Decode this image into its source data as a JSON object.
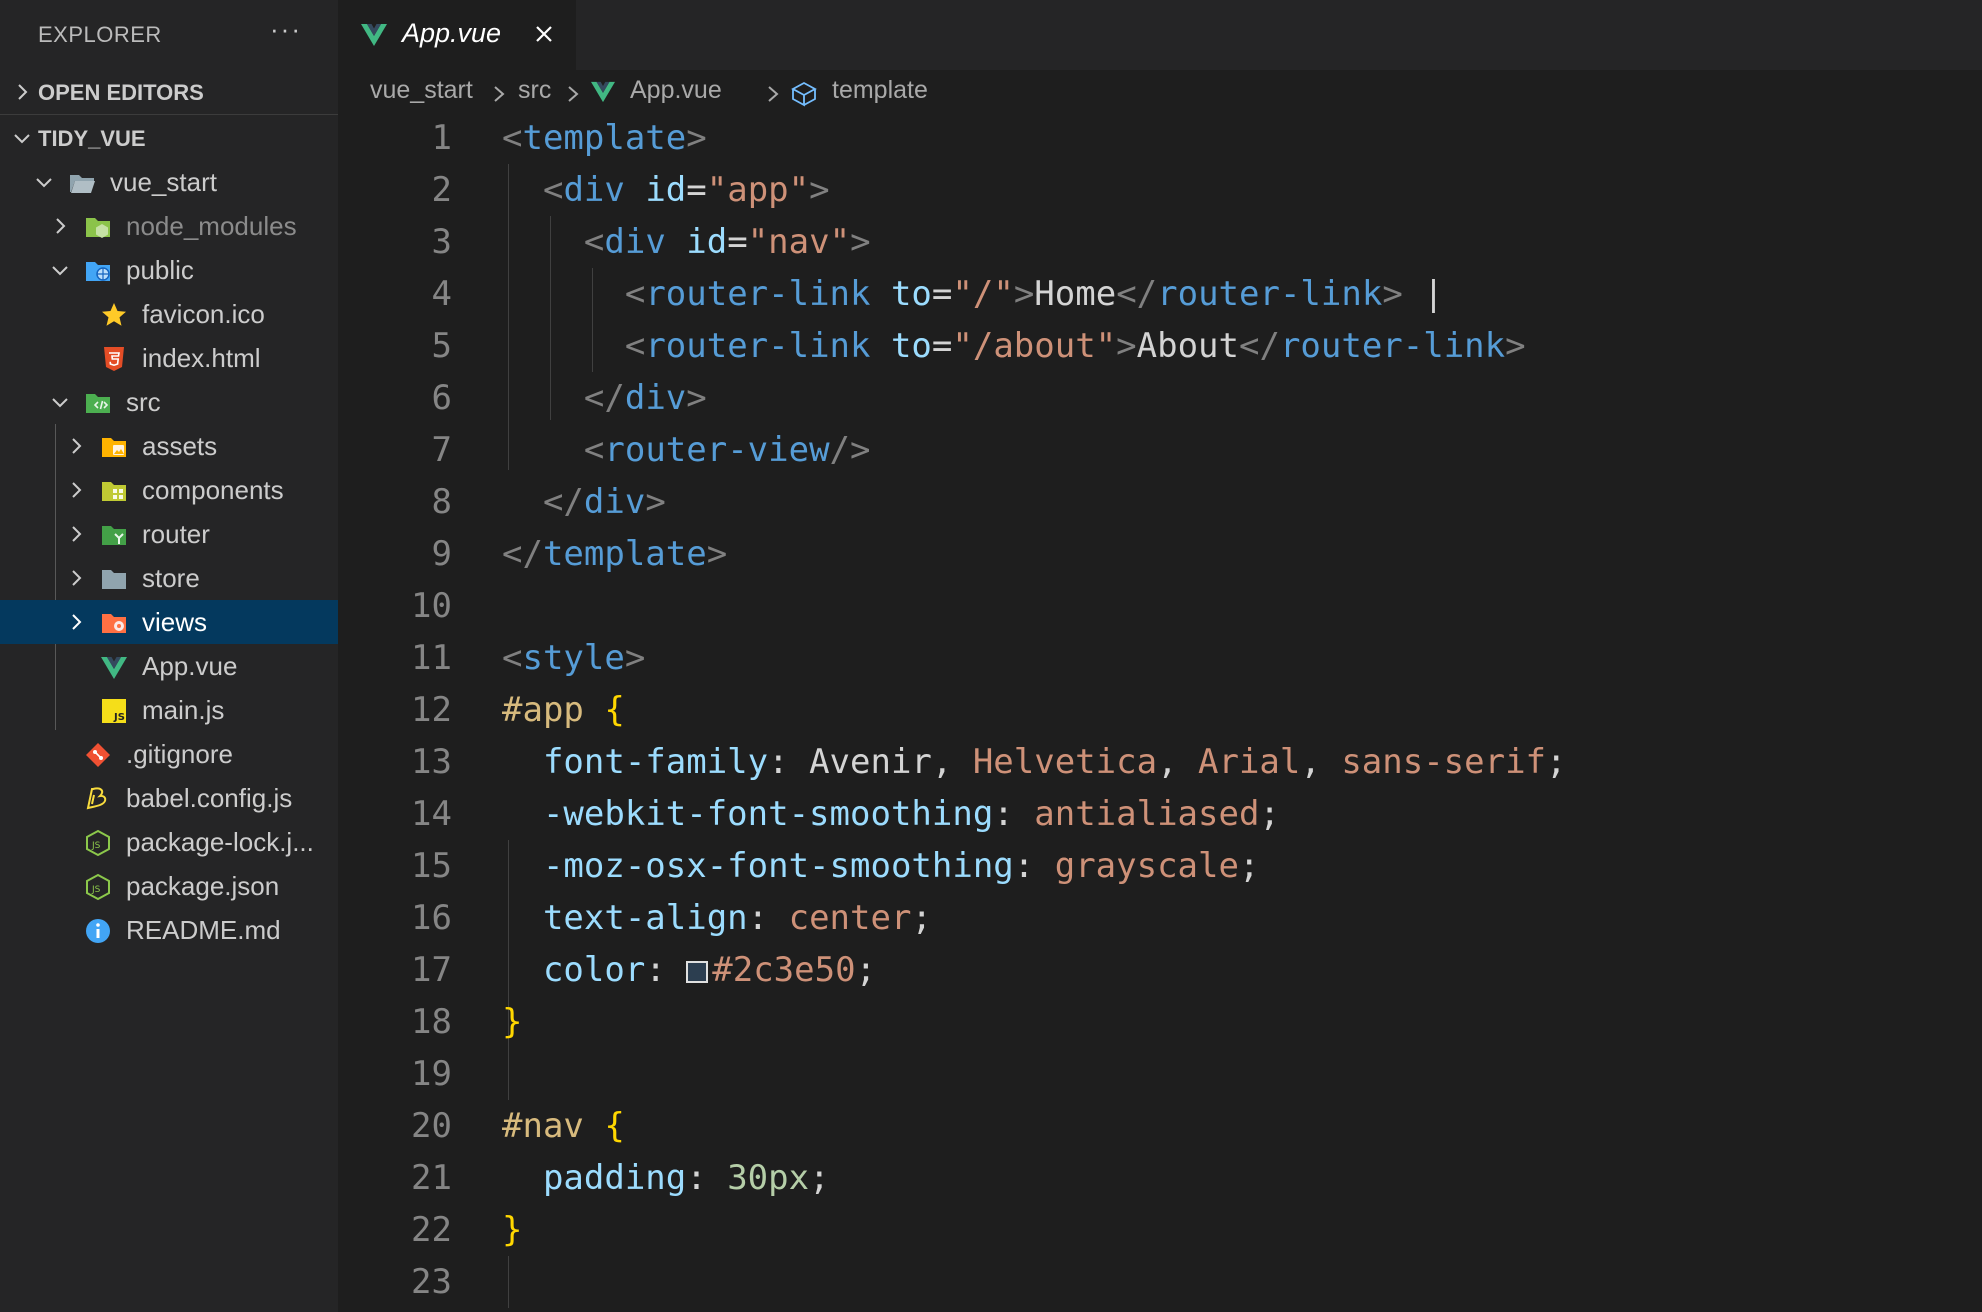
{
  "sidebar": {
    "title": "EXPLORER",
    "more": "···",
    "sections": {
      "open_editors": "OPEN EDITORS",
      "project": "TIDY_VUE"
    },
    "tree": [
      {
        "label": "vue_start",
        "expanded": true,
        "icon": "folder-open-icon"
      },
      {
        "label": "node_modules",
        "expanded": false,
        "icon": "node-folder-icon"
      },
      {
        "label": "public",
        "expanded": true,
        "icon": "public-folder-icon"
      },
      {
        "label": "favicon.ico",
        "icon": "star-icon"
      },
      {
        "label": "index.html",
        "icon": "html5-icon"
      },
      {
        "label": "src",
        "expanded": true,
        "icon": "src-folder-icon"
      },
      {
        "label": "assets",
        "expanded": false,
        "icon": "assets-folder-icon"
      },
      {
        "label": "components",
        "expanded": false,
        "icon": "components-folder-icon"
      },
      {
        "label": "router",
        "expanded": false,
        "icon": "router-folder-icon"
      },
      {
        "label": "store",
        "expanded": false,
        "icon": "folder-icon"
      },
      {
        "label": "views",
        "expanded": false,
        "icon": "views-folder-icon",
        "selected": true
      },
      {
        "label": "App.vue",
        "icon": "vue-icon"
      },
      {
        "label": "main.js",
        "icon": "js-icon"
      },
      {
        "label": ".gitignore",
        "icon": "git-icon"
      },
      {
        "label": "babel.config.js",
        "icon": "babel-icon"
      },
      {
        "label": "package-lock.j...",
        "icon": "nodejs-icon"
      },
      {
        "label": "package.json",
        "icon": "nodejs-icon"
      },
      {
        "label": "README.md",
        "icon": "info-icon"
      }
    ]
  },
  "editor": {
    "tab": {
      "label": "App.vue",
      "icon": "vue-icon"
    },
    "breadcrumb": [
      "vue_start",
      "src",
      "App.vue",
      "template"
    ],
    "lines": [
      "1",
      "2",
      "3",
      "4",
      "5",
      "6",
      "7",
      "8",
      "9",
      "10",
      "11",
      "12",
      "13",
      "14",
      "15",
      "16",
      "17",
      "18",
      "19",
      "20",
      "21",
      "22",
      "23"
    ],
    "code": {
      "l1": {
        "a": "<",
        "b": "template",
        "c": ">"
      },
      "l2": {
        "a": "<",
        "b": "div",
        "c": " id",
        "d": "=",
        "e": "\"app\"",
        "f": ">"
      },
      "l3": {
        "a": "<",
        "b": "div",
        "c": " id",
        "d": "=",
        "e": "\"nav\"",
        "f": ">"
      },
      "l4": {
        "a": "<",
        "b": "router-link",
        "c": " to",
        "d": "=",
        "e": "\"/\"",
        "f": ">",
        "g": "Home",
        "h": "</",
        "i": "router-link",
        "j": ">",
        "k": " |"
      },
      "l5": {
        "a": "<",
        "b": "router-link",
        "c": " to",
        "d": "=",
        "e": "\"/about\"",
        "f": ">",
        "g": "About",
        "h": "</",
        "i": "router-link",
        "j": ">"
      },
      "l6": {
        "a": "</",
        "b": "div",
        "c": ">"
      },
      "l7": {
        "a": "<",
        "b": "router-view",
        "c": "/>"
      },
      "l8": {
        "a": "</",
        "b": "div",
        "c": ">"
      },
      "l9": {
        "a": "</",
        "b": "template",
        "c": ">"
      },
      "l11": {
        "a": "<",
        "b": "style",
        "c": ">"
      },
      "l12": {
        "a": "#app",
        "b": " {"
      },
      "l13": {
        "a": "font-family",
        "b": ": Avenir, ",
        "c": "Helvetica",
        "d": ", ",
        "e": "Arial",
        "f": ", ",
        "g": "sans-serif",
        "h": ";"
      },
      "l14": {
        "a": "-webkit-font-smoothing",
        "b": ": ",
        "c": "antialiased",
        "d": ";"
      },
      "l15": {
        "a": "-moz-osx-font-smoothing",
        "b": ": ",
        "c": "grayscale",
        "d": ";"
      },
      "l16": {
        "a": "text-align",
        "b": ": ",
        "c": "center",
        "d": ";"
      },
      "l17": {
        "a": "color",
        "b": ": ",
        "c": "#2c3e50",
        "d": ";"
      },
      "l18": {
        "a": "}"
      },
      "l20": {
        "a": "#nav",
        "b": " {"
      },
      "l21": {
        "a": "padding",
        "b": ": ",
        "c": "30px",
        "d": ";"
      },
      "l22": {
        "a": "}"
      }
    }
  },
  "colors": {
    "sidebar_bg": "#252526",
    "editor_bg": "#1e1e1e",
    "selection": "#04395e",
    "swatch": "#2c3e50"
  }
}
